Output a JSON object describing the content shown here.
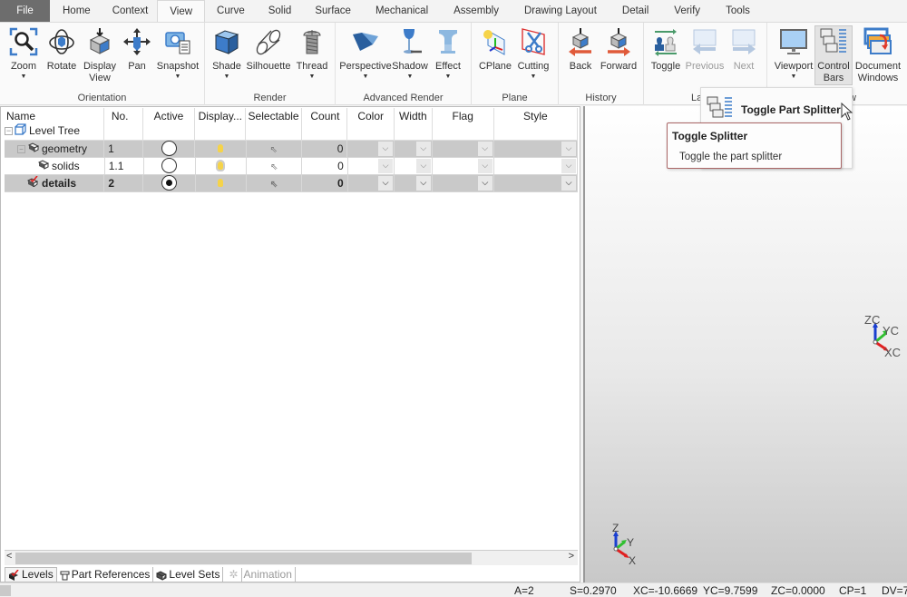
{
  "menu_tabs": [
    "File",
    "Home",
    "Context",
    "View",
    "Curve",
    "Solid",
    "Surface",
    "Mechanical",
    "Assembly",
    "Drawing Layout",
    "Detail",
    "Verify",
    "Tools"
  ],
  "active_tab": "View",
  "ribbon": {
    "groups": [
      {
        "label": "Orientation",
        "buttons": [
          {
            "label": "Zoom",
            "dropdown": true
          },
          {
            "label": "Rotate"
          },
          {
            "label": "Display View"
          },
          {
            "label": "Pan"
          },
          {
            "label": "Snapshot",
            "dropdown": true
          }
        ]
      },
      {
        "label": "Render",
        "buttons": [
          {
            "label": "Shade",
            "dropdown": true
          },
          {
            "label": "Silhouette"
          },
          {
            "label": "Thread",
            "dropdown": true
          }
        ]
      },
      {
        "label": "Advanced Render",
        "buttons": [
          {
            "label": "Perspective",
            "dropdown": true
          },
          {
            "label": "Shadow",
            "dropdown": true
          },
          {
            "label": "Effect",
            "dropdown": true
          }
        ]
      },
      {
        "label": "Plane",
        "buttons": [
          {
            "label": "CPlane"
          },
          {
            "label": "Cutting",
            "dropdown": true
          }
        ]
      },
      {
        "label": "History",
        "buttons": [
          {
            "label": "Back"
          },
          {
            "label": "Forward"
          }
        ]
      },
      {
        "label": "La",
        "buttons": [
          {
            "label": "Toggle"
          },
          {
            "label": "Previous",
            "disabled": true
          },
          {
            "label": "Next",
            "disabled": true
          }
        ]
      },
      {
        "label": "w",
        "buttons": [
          {
            "label": "Viewport",
            "dropdown": true
          },
          {
            "label": "Control Bars",
            "dropdown": true,
            "pressed": true
          },
          {
            "label": "Document Windows",
            "dropdown": true
          }
        ]
      }
    ]
  },
  "level_grid": {
    "columns": [
      "Name",
      "No.",
      "Active",
      "Display...",
      "Selectable",
      "Count",
      "Color",
      "Width",
      "Flag",
      "Style"
    ],
    "rows": [
      {
        "name": "Level Tree",
        "no": "",
        "count": "",
        "root": true
      },
      {
        "name": "geometry",
        "no": "1",
        "active": false,
        "count": "0",
        "selected": true
      },
      {
        "name": "solids",
        "no": "1.1",
        "active": false,
        "count": "0",
        "selected": false
      },
      {
        "name": "details",
        "no": "2",
        "active": true,
        "count": "0",
        "selected": true,
        "bold": true
      }
    ]
  },
  "bottom_tabs": [
    {
      "label": "Levels",
      "active": true
    },
    {
      "label": "Part References"
    },
    {
      "label": "Level Sets"
    },
    {
      "label": "Animation",
      "disabled": true
    }
  ],
  "dropdown_menu": {
    "item": "Toggle Part Splitter"
  },
  "tooltip": {
    "title": "Toggle Splitter",
    "description": "Toggle the part splitter"
  },
  "triad_large": {
    "z": "ZC",
    "y": "YC",
    "x": "XC"
  },
  "triad_small": {
    "z": "Z",
    "y": "Y",
    "x": "X"
  },
  "status": {
    "a": "A=2",
    "s": "S=0.2970",
    "xc": "XC=-10.6669",
    "yc": "YC=9.7599",
    "zc": "ZC=0.0000",
    "cp": "CP=1",
    "dv": "DV=7"
  },
  "colors": {
    "file_tab": "#6d6d6d",
    "tooltip_border": "#aa6666",
    "accent_blue": "#3d7cc9",
    "x_axis": "#e02020",
    "y_axis": "#30c030",
    "z_axis": "#1a3fd0"
  }
}
